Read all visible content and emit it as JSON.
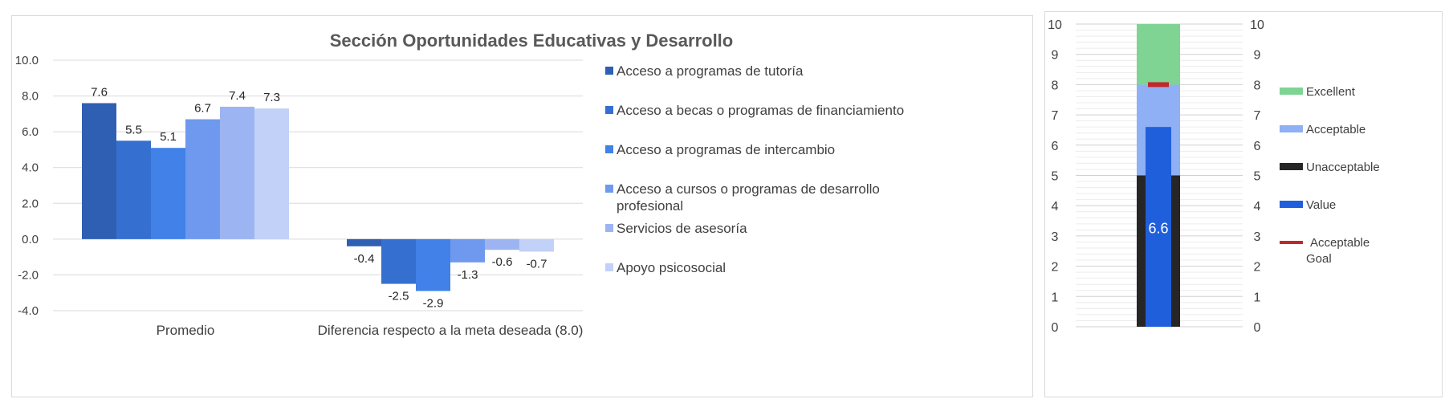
{
  "chart_data": [
    {
      "type": "bar",
      "title": "Sección Oportunidades Educativas y Desarrollo",
      "categories": [
        "Promedio",
        "Diferencia respecto a la meta deseada (8.0)"
      ],
      "ylim": [
        -4,
        10
      ],
      "yticks": [
        "-4.0",
        "-2.0",
        "0.0",
        "2.0",
        "4.0",
        "6.0",
        "8.0",
        "10.0"
      ],
      "grid": true,
      "legend_position": "right",
      "series": [
        {
          "name": "Acceso a programas de tutoría",
          "values": [
            7.6,
            -0.4
          ],
          "labels": [
            "7.6",
            "-0.4"
          ],
          "color": "#2f5fb3"
        },
        {
          "name": "Acceso a becas o programas de financiamiento",
          "values": [
            5.5,
            -2.5
          ],
          "labels": [
            "5.5",
            "-2.5"
          ],
          "color": "#3570d0"
        },
        {
          "name": "Acceso a programas de intercambio",
          "values": [
            5.1,
            -2.9
          ],
          "labels": [
            "5.1",
            "-2.9"
          ],
          "color": "#4181e8"
        },
        {
          "name": "Acceso a cursos o programas de desarrollo profesional",
          "name_lines": [
            "Acceso a cursos o programas de desarrollo",
            "profesional"
          ],
          "values": [
            6.7,
            -1.3
          ],
          "labels": [
            "6.7",
            "-1.3"
          ],
          "color": "#6f99ee"
        },
        {
          "name": "Servicios de asesoría",
          "values": [
            7.4,
            -0.6
          ],
          "labels": [
            "7.4",
            "-0.6"
          ],
          "color": "#9cb5f2"
        },
        {
          "name": "Apoyo psicosocial",
          "values": [
            7.3,
            -0.7
          ],
          "labels": [
            "7.3",
            "-0.7"
          ],
          "color": "#c2d1f7"
        }
      ]
    },
    {
      "type": "bar",
      "subtype": "bullet",
      "ylim": [
        0,
        10
      ],
      "yticks": [
        "0",
        "1",
        "2",
        "3",
        "4",
        "5",
        "6",
        "7",
        "8",
        "9",
        "10"
      ],
      "grid": true,
      "legend_position": "right",
      "bands": [
        {
          "name": "Unacceptable",
          "from": 0,
          "to": 5,
          "color": "#262626"
        },
        {
          "name": "Acceptable",
          "from": 5,
          "to": 8,
          "color": "#8fb0f5"
        },
        {
          "name": "Excellent",
          "from": 8,
          "to": 10,
          "color": "#7fd493"
        }
      ],
      "value": 6.6,
      "value_label": "6.6",
      "value_name": "Value",
      "value_color": "#1f5fdb",
      "goal": 8,
      "goal_name": "Acceptable Goal",
      "goal_name_lines": [
        "Acceptable",
        "Goal"
      ],
      "goal_color": "#c0282a",
      "legend_order": [
        "Excellent",
        "Acceptable",
        "Unacceptable",
        "Value",
        "Acceptable Goal"
      ]
    }
  ]
}
